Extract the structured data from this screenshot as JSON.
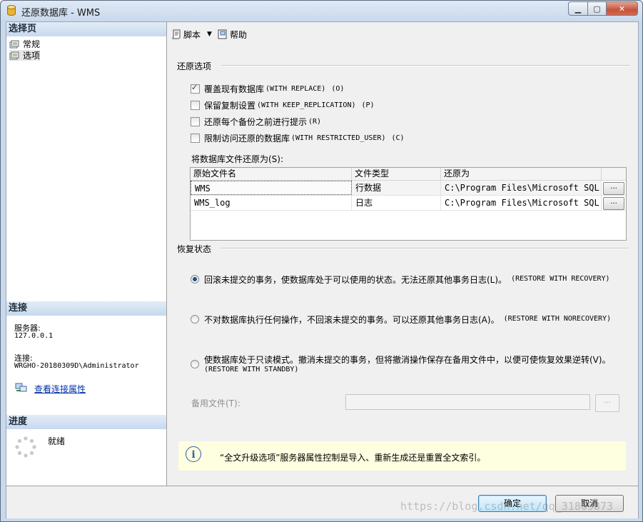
{
  "window": {
    "title": "还原数据库 - WMS",
    "controls": [
      "minimize",
      "maximize",
      "close"
    ]
  },
  "left_pane": {
    "select_page_header": "选择页",
    "pages": [
      {
        "label": "常规",
        "icon": "page-icon"
      },
      {
        "label": "选项",
        "icon": "page-icon"
      }
    ],
    "connection": {
      "header": "连接",
      "server_label": "服务器:",
      "server_value": "127.0.0.1",
      "connection_label": "连接:",
      "connection_value": "WRGHO-20180309D\\Administrator",
      "view_properties_link": "查看连接属性"
    },
    "progress": {
      "header": "进度",
      "status": "就绪"
    }
  },
  "toolbar": {
    "script_label": "脚本",
    "help_label": "帮助"
  },
  "restore_options": {
    "title": "还原选项",
    "checkboxes": [
      {
        "label": "覆盖现有数据库",
        "code": "(WITH REPLACE)",
        "accel": "(O)",
        "checked": true
      },
      {
        "label": "保留复制设置",
        "code": "(WITH KEEP_REPLICATION)",
        "accel": "(P)",
        "checked": false
      },
      {
        "label": "还原每个备份之前进行提示",
        "code": "",
        "accel": "(R)",
        "checked": false
      },
      {
        "label": "限制访问还原的数据库",
        "code": "(WITH RESTRICTED_USER)",
        "accel": "(C)",
        "checked": false
      }
    ],
    "restore_files_label": "将数据库文件还原为(S):",
    "grid": {
      "columns": [
        "原始文件名",
        "文件类型",
        "还原为"
      ],
      "rows": [
        {
          "original": "WMS",
          "type": "行数据",
          "restore_as": "C:\\Program Files\\Microsoft SQL S...",
          "button": "..."
        },
        {
          "original": "WMS_log",
          "type": "日志",
          "restore_as": "C:\\Program Files\\Microsoft SQL S...",
          "button": "..."
        }
      ]
    }
  },
  "recovery_state": {
    "title": "恢复状态",
    "options": [
      {
        "text": "回滚未提交的事务，使数据库处于可以使用的状态。无法还原其他事务日志(L)。",
        "code": "(RESTORE WITH RECOVERY)",
        "selected": true
      },
      {
        "text": "不对数据库执行任何操作，不回滚未提交的事务。可以还原其他事务日志(A)。",
        "code": "(RESTORE WITH NORECOVERY)",
        "selected": false
      },
      {
        "text": "使数据库处于只读模式。撤消未提交的事务，但将撤消操作保存在备用文件中，以便可使恢复效果逆转(V)。",
        "code": "(RESTORE WITH STANDBY)",
        "selected": false
      }
    ],
    "standby_file_label": "备用文件(T):",
    "standby_file_value": "",
    "standby_browse": "..."
  },
  "info": {
    "icon": "info-icon",
    "text": "“全文升级选项”服务器属性控制是导入、重新生成还是重置全文索引。"
  },
  "buttons": {
    "ok": "确定",
    "cancel": "取消"
  },
  "watermark": "https://blog.csdn.net/qq_31869873"
}
